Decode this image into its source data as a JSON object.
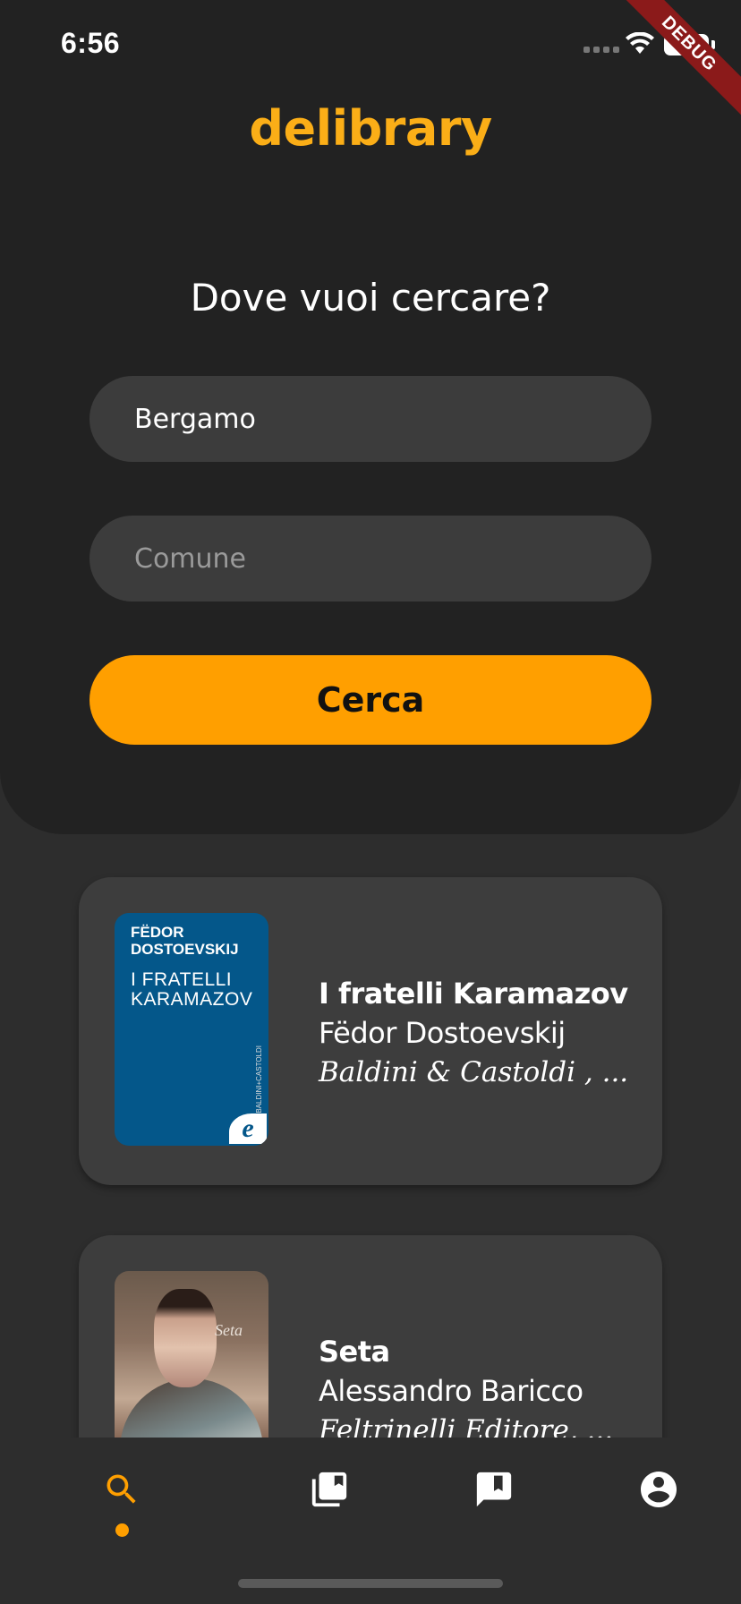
{
  "status_bar": {
    "time": "6:56",
    "debug_label": "DEBUG"
  },
  "header": {
    "brand": "delibrary",
    "question": "Dove vuoi cercare?"
  },
  "search_form": {
    "province_value": "Bergamo",
    "comune_placeholder": "Comune",
    "button_label": "Cerca"
  },
  "results": [
    {
      "title": "I fratelli Karamazov",
      "author": "Fëdor Dostoevskij",
      "publisher": "Baldini & Castoldi , ...",
      "cover": {
        "author": "FËDOR DOSTOEVSKIJ",
        "title": "I FRATELLI KARAMAZOV",
        "publisher": "BALDINI+CASTOLDI",
        "logo": "e",
        "color": "#04578a"
      }
    },
    {
      "title": "Seta",
      "author": "Alessandro Baricco",
      "publisher": "Feltrinelli Editore, ...",
      "cover": {
        "title": "Seta"
      }
    }
  ],
  "bottom_nav": {
    "items": [
      {
        "icon": "search-icon",
        "active": true
      },
      {
        "icon": "library-books-icon",
        "active": false
      },
      {
        "icon": "bookmark-icon",
        "active": false
      },
      {
        "icon": "account-circle-icon",
        "active": false
      }
    ],
    "active_color": "#ff9f00",
    "inactive_color": "#ffffff"
  },
  "colors": {
    "brand": "#fbae17",
    "accent": "#ff9f00",
    "header_bg": "#222222",
    "page_bg": "#2d2d2d",
    "card_bg": "#3d3d3d",
    "input_bg": "#3c3c3c"
  }
}
